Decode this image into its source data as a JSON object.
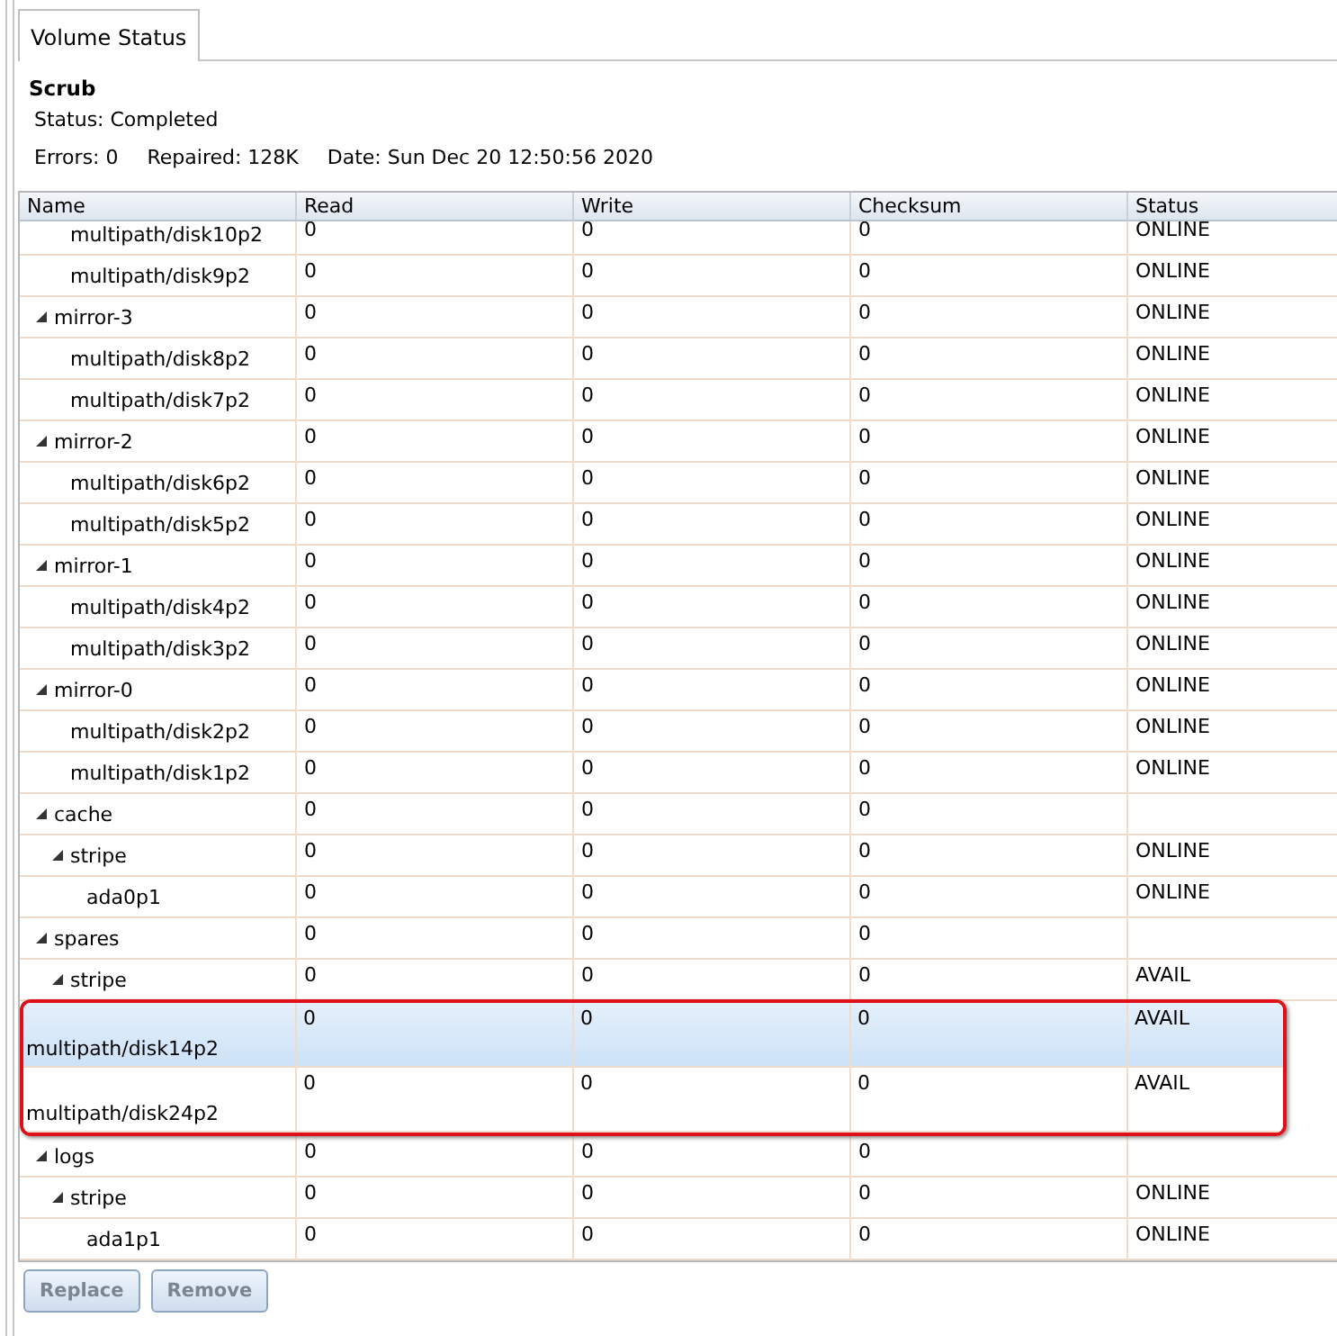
{
  "tabs": [
    {
      "label": "Volume Status",
      "selected": true
    }
  ],
  "scrub": {
    "title": "Scrub",
    "status": "Status: Completed",
    "errors": "Errors: 0",
    "repaired": "Repaired: 128K",
    "date": "Date: Sun Dec 20 12:50:56 2020"
  },
  "table": {
    "columns": [
      "Name",
      "Read",
      "Write",
      "Checksum",
      "Status"
    ],
    "rows": [
      {
        "children": [
          {
            "name": "multipath/disk10p2",
            "read": "0",
            "write": "0",
            "checksum": "0",
            "status": "ONLINE"
          },
          {
            "name": "multipath/disk9p2",
            "read": "0",
            "write": "0",
            "checksum": "0",
            "status": "ONLINE"
          }
        ]
      },
      {
        "name": "mirror-3",
        "expanded": true,
        "read": "0",
        "write": "0",
        "checksum": "0",
        "status": "ONLINE",
        "children": [
          {
            "name": "multipath/disk8p2",
            "read": "0",
            "write": "0",
            "checksum": "0",
            "status": "ONLINE"
          },
          {
            "name": "multipath/disk7p2",
            "read": "0",
            "write": "0",
            "checksum": "0",
            "status": "ONLINE"
          }
        ]
      },
      {
        "name": "mirror-2",
        "expanded": true,
        "read": "0",
        "write": "0",
        "checksum": "0",
        "status": "ONLINE",
        "children": [
          {
            "name": "multipath/disk6p2",
            "read": "0",
            "write": "0",
            "checksum": "0",
            "status": "ONLINE"
          },
          {
            "name": "multipath/disk5p2",
            "read": "0",
            "write": "0",
            "checksum": "0",
            "status": "ONLINE"
          }
        ]
      },
      {
        "name": "mirror-1",
        "expanded": true,
        "read": "0",
        "write": "0",
        "checksum": "0",
        "status": "ONLINE",
        "children": [
          {
            "name": "multipath/disk4p2",
            "read": "0",
            "write": "0",
            "checksum": "0",
            "status": "ONLINE"
          },
          {
            "name": "multipath/disk3p2",
            "read": "0",
            "write": "0",
            "checksum": "0",
            "status": "ONLINE"
          }
        ]
      },
      {
        "name": "mirror-0",
        "expanded": true,
        "read": "0",
        "write": "0",
        "checksum": "0",
        "status": "ONLINE",
        "children": [
          {
            "name": "multipath/disk2p2",
            "read": "0",
            "write": "0",
            "checksum": "0",
            "status": "ONLINE"
          },
          {
            "name": "multipath/disk1p2",
            "read": "0",
            "write": "0",
            "checksum": "0",
            "status": "ONLINE"
          }
        ]
      },
      {
        "name": "cache",
        "expanded": true,
        "read": "0",
        "write": "0",
        "checksum": "0",
        "children": [
          {
            "name": "stripe",
            "expanded": true,
            "read": "0",
            "write": "0",
            "checksum": "0",
            "status": "ONLINE",
            "children": [
              {
                "name": "ada0p1",
                "read": "0",
                "write": "0",
                "checksum": "0",
                "status": "ONLINE"
              }
            ]
          }
        ]
      },
      {
        "name": "spares",
        "expanded": true,
        "read": "0",
        "write": "0",
        "checksum": "0",
        "children": [
          {
            "name": "stripe",
            "expanded": true,
            "read": "0",
            "write": "0",
            "checksum": "0",
            "status": "AVAIL",
            "children": [
              {
                "name": "multipath/disk14p2",
                "kind": "tall",
                "selected": true,
                "highlighted": true,
                "read": "0",
                "write": "0",
                "checksum": "0",
                "status": "AVAIL"
              },
              {
                "name": "multipath/disk24p2",
                "kind": "tall",
                "selected": false,
                "highlighted": true,
                "read": "0",
                "write": "0",
                "checksum": "0",
                "status": "AVAIL"
              }
            ]
          }
        ]
      },
      {
        "name": "logs",
        "expanded": true,
        "read": "0",
        "write": "0",
        "checksum": "0",
        "children": [
          {
            "name": "stripe",
            "expanded": true,
            "read": "0",
            "write": "0",
            "checksum": "0",
            "status": "ONLINE",
            "children": [
              {
                "name": "ada1p1",
                "read": "0",
                "write": "0",
                "checksum": "0",
                "status": "ONLINE"
              }
            ]
          }
        ]
      }
    ]
  },
  "buttons": [
    {
      "label": "Replace",
      "disabled": true
    },
    {
      "label": "Remove",
      "disabled": true
    }
  ]
}
